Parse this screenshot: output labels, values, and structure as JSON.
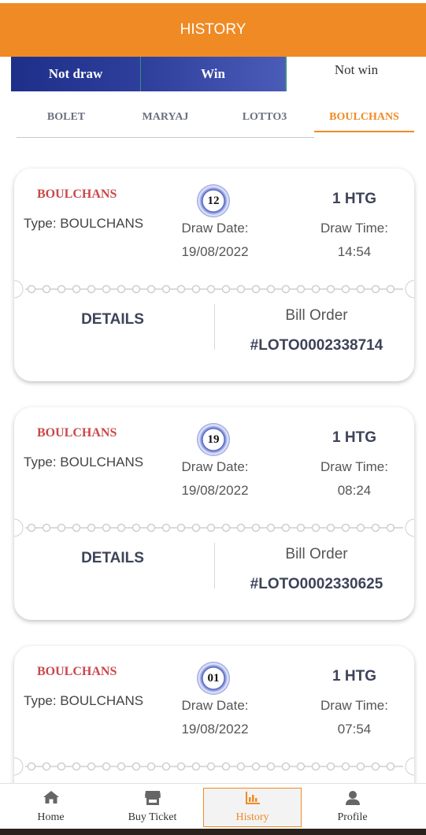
{
  "header": {
    "title": "HISTORY"
  },
  "status_tabs": [
    {
      "label": "Not draw"
    },
    {
      "label": "Win"
    },
    {
      "label": "Not win"
    }
  ],
  "game_tabs": [
    {
      "label": "BOLET"
    },
    {
      "label": "MARYAJ"
    },
    {
      "label": "LOTTO3"
    },
    {
      "label": "BOULCHANS",
      "active": true
    }
  ],
  "tickets": [
    {
      "game": "BOULCHANS",
      "type": "Type: BOULCHANS",
      "ball": "12",
      "price": "1 HTG",
      "draw_date_label": "Draw Date:",
      "draw_date": "19/08/2022",
      "draw_time_label": "Draw Time:",
      "draw_time": "14:54",
      "details_label": "DETAILS",
      "bill_label": "Bill Order",
      "bill_number": "#LOTO0002338714"
    },
    {
      "game": "BOULCHANS",
      "type": "Type: BOULCHANS",
      "ball": "19",
      "price": "1 HTG",
      "draw_date_label": "Draw Date:",
      "draw_date": "19/08/2022",
      "draw_time_label": "Draw Time:",
      "draw_time": "08:24",
      "details_label": "DETAILS",
      "bill_label": "Bill Order",
      "bill_number": "#LOTO0002330625"
    },
    {
      "game": "BOULCHANS",
      "type": "Type: BOULCHANS",
      "ball": "01",
      "price": "1 HTG",
      "draw_date_label": "Draw Date:",
      "draw_date": "19/08/2022",
      "draw_time_label": "Draw Time:",
      "draw_time": "07:54",
      "details_label": "",
      "bill_label": "",
      "bill_number": ""
    }
  ],
  "bottom_nav": [
    {
      "label": "Home",
      "icon": "home-icon"
    },
    {
      "label": "Buy Ticket",
      "icon": "store-icon"
    },
    {
      "label": "History",
      "icon": "bar-chart-icon",
      "active": true
    },
    {
      "label": "Profile",
      "icon": "user-icon"
    }
  ],
  "colors": {
    "accent": "#f08a24",
    "tab_blue": "#2d3f9b",
    "game_red": "#c9484a",
    "text_dark": "#3d4358"
  }
}
